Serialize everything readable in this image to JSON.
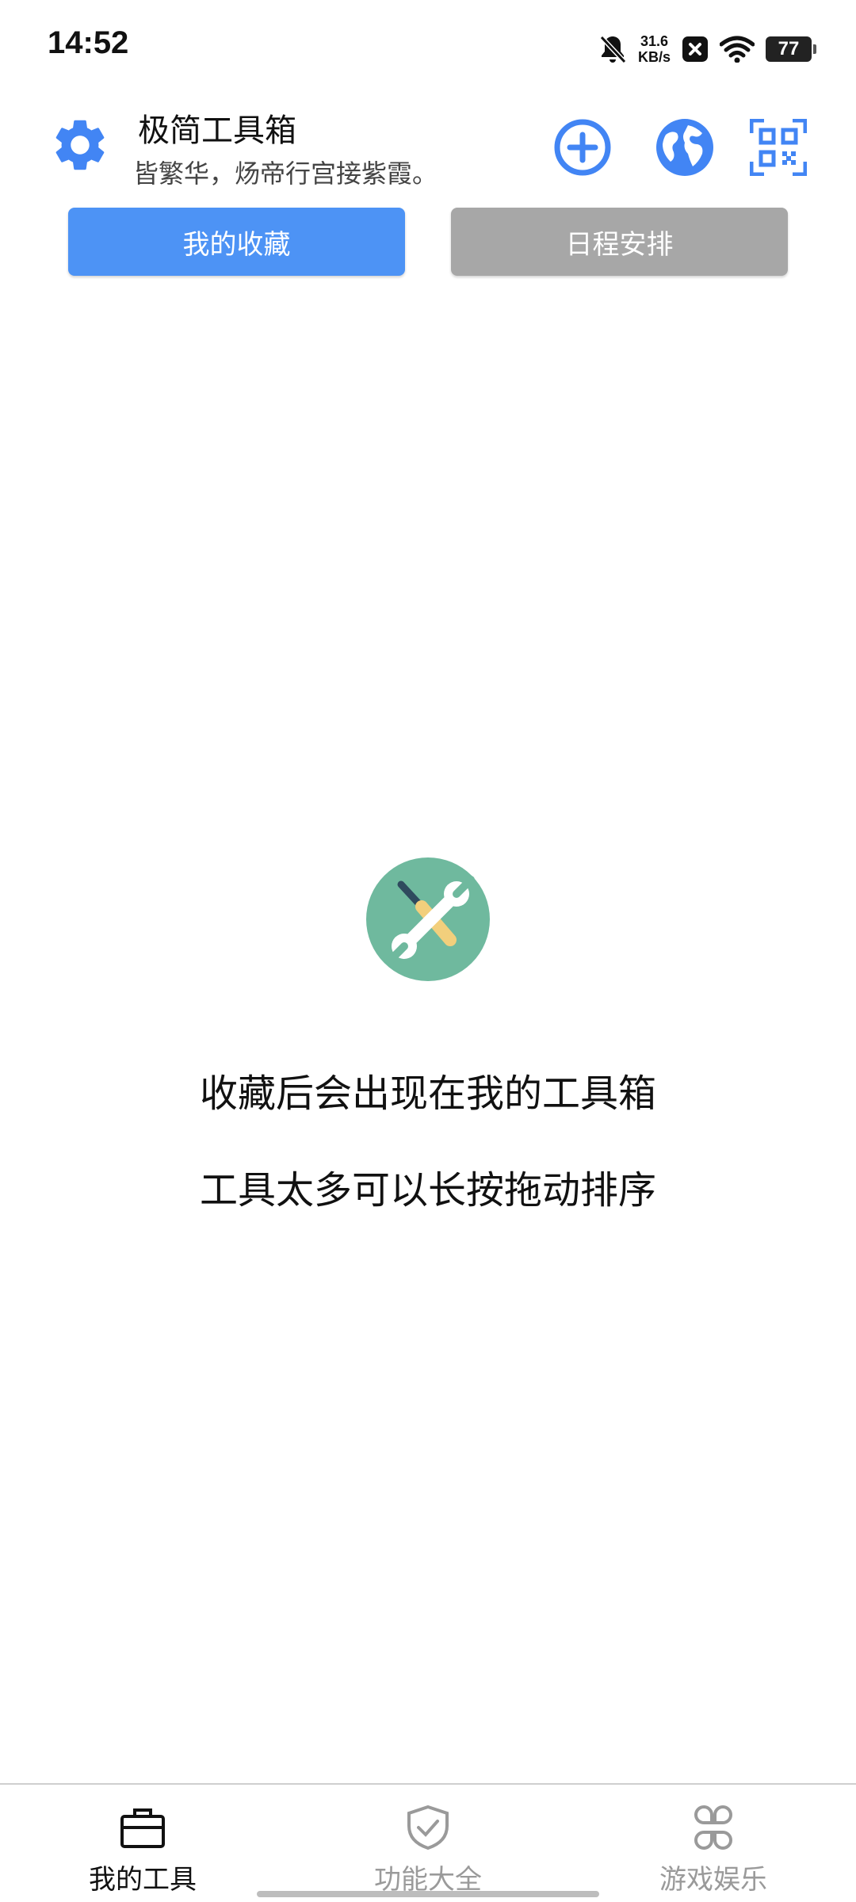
{
  "status_bar": {
    "time": "14:52",
    "net_speed_value": "31.6",
    "net_speed_unit": "KB/s",
    "battery": "77",
    "icons": [
      "bell-muted-icon",
      "app-notification-icon",
      "wifi-icon",
      "battery-icon"
    ]
  },
  "header": {
    "title": "极简工具箱",
    "subtitle": "皆繁华，炀帝行宫接紫霞。",
    "icons": [
      "settings-icon",
      "add-circle-icon",
      "globe-icon",
      "qr-scan-icon"
    ],
    "accent_color": "#4285f4"
  },
  "tabs": [
    {
      "label": "我的收藏",
      "active": true,
      "color": "#4d93f5"
    },
    {
      "label": "日程安排",
      "active": false,
      "color": "#a7a7a7"
    }
  ],
  "empty_state": {
    "icon": "tools-icon",
    "line1": "收藏后会出现在我的工具箱",
    "line2": "工具太多可以长按拖动排序"
  },
  "bottom_nav": [
    {
      "label": "我的工具",
      "icon": "toolbox-icon",
      "active": true
    },
    {
      "label": "功能大全",
      "icon": "shield-check-icon",
      "active": false
    },
    {
      "label": "游戏娱乐",
      "icon": "apps-grid-icon",
      "active": false
    }
  ]
}
